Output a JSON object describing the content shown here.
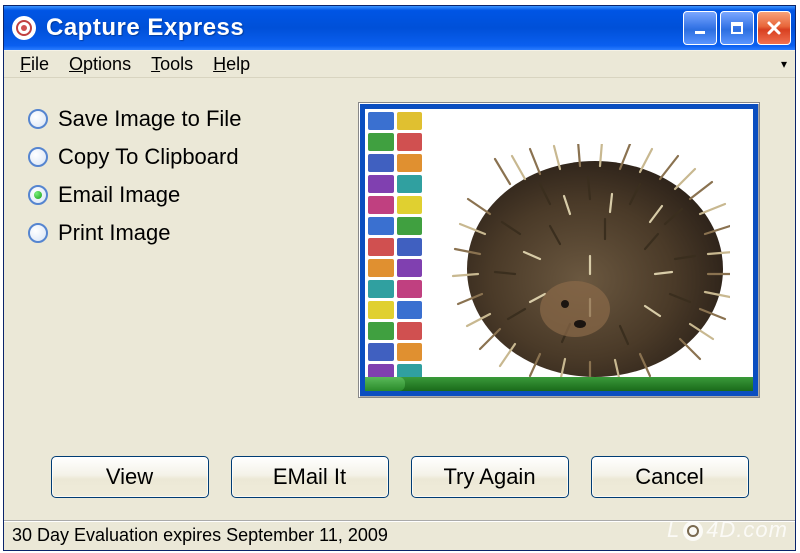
{
  "window": {
    "title": "Capture Express"
  },
  "menu": {
    "items": [
      {
        "label": "File",
        "accel": "F"
      },
      {
        "label": "Options",
        "accel": "O"
      },
      {
        "label": "Tools",
        "accel": "T"
      },
      {
        "label": "Help",
        "accel": "H"
      }
    ]
  },
  "options": {
    "items": [
      {
        "label": "Save Image to File",
        "selected": false
      },
      {
        "label": "Copy To Clipboard",
        "selected": false
      },
      {
        "label": "Email Image",
        "selected": true
      },
      {
        "label": "Print Image",
        "selected": false
      }
    ]
  },
  "buttons": {
    "view": "View",
    "primary": "EMail It",
    "retry": "Try Again",
    "cancel": "Cancel"
  },
  "status": {
    "text": "30 Day Evaluation expires September  11, 2009"
  },
  "watermark": "LO4D.com"
}
